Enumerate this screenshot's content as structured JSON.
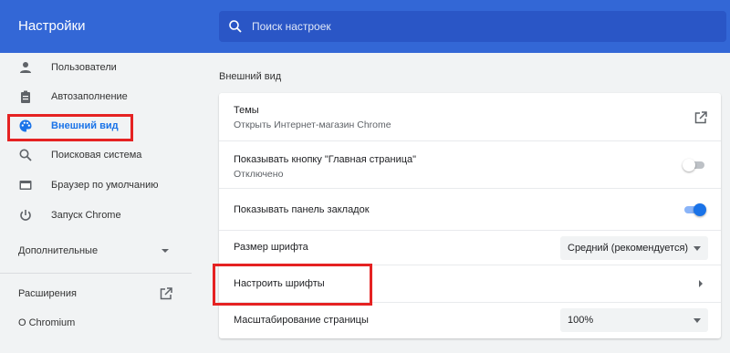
{
  "header": {
    "title": "Настройки",
    "search": {
      "placeholder": "Поиск настроек",
      "icon": "search-icon"
    }
  },
  "sidebar": {
    "items": [
      {
        "label": "Пользователи",
        "icon": "person-icon"
      },
      {
        "label": "Автозаполнение",
        "icon": "clipboard-icon"
      },
      {
        "label": "Внешний вид",
        "icon": "palette-icon",
        "active": true
      },
      {
        "label": "Поисковая система",
        "icon": "search-icon"
      },
      {
        "label": "Браузер по умолчанию",
        "icon": "browser-icon"
      },
      {
        "label": "Запуск Chrome",
        "icon": "power-icon"
      }
    ],
    "advanced": {
      "label": "Дополнительные",
      "icon": "chevron-down-icon"
    },
    "extensions": {
      "label": "Расширения",
      "icon": "external-link-icon"
    },
    "about": {
      "label": "О Chromium"
    }
  },
  "main": {
    "section_title": "Внешний вид",
    "rows": {
      "themes": {
        "title": "Темы",
        "subtitle": "Открыть Интернет-магазин Chrome",
        "icon": "external-link-icon"
      },
      "home_button": {
        "title": "Показывать кнопку \"Главная страница\"",
        "subtitle": "Отключено",
        "enabled": false
      },
      "bookmarks_bar": {
        "title": "Показывать панель закладок",
        "enabled": true
      },
      "font_size": {
        "title": "Размер шрифта",
        "value": "Средний (рекомендуется)"
      },
      "customize_fonts": {
        "title": "Настроить шрифты"
      },
      "page_zoom": {
        "title": "Масштабирование страницы",
        "value": "100%"
      }
    }
  },
  "colors": {
    "header": "#3367d6",
    "accent": "#1a73e8",
    "highlight": "#e52222"
  }
}
